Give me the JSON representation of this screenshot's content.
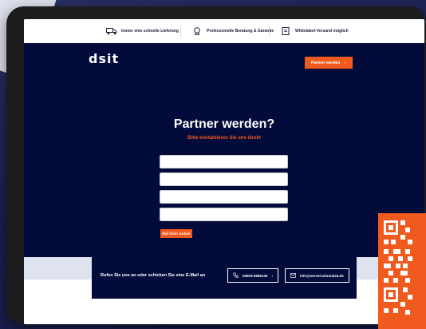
{
  "topbar": {
    "items": [
      {
        "icon": "truck-icon",
        "label": "Immer eine schnelle Lieferung"
      },
      {
        "icon": "badge-icon",
        "label": "Professionelle Beratung & Garantie"
      },
      {
        "icon": "label-icon",
        "label": "Whitelabel-Versand möglich"
      }
    ]
  },
  "header": {
    "logo": "dsit",
    "partner_button": "Partner werden",
    "partner_arrow": "›"
  },
  "hero": {
    "title": "Partner werden?",
    "subtitle": "Bitte kontaktieren Sie uns direkt"
  },
  "form": {
    "fields": [
      "",
      "",
      "",
      ""
    ],
    "submit_label": "Ruf mich zurück"
  },
  "contact": {
    "text": "Rufen Sie uns an oder schicken Sie eine E-Mail an",
    "phone": "05903-9689130",
    "phone_arrow": "›",
    "email": "info@serverschrank24.de"
  },
  "colors": {
    "accent": "#f05a1e",
    "navy": "#030b3a"
  }
}
